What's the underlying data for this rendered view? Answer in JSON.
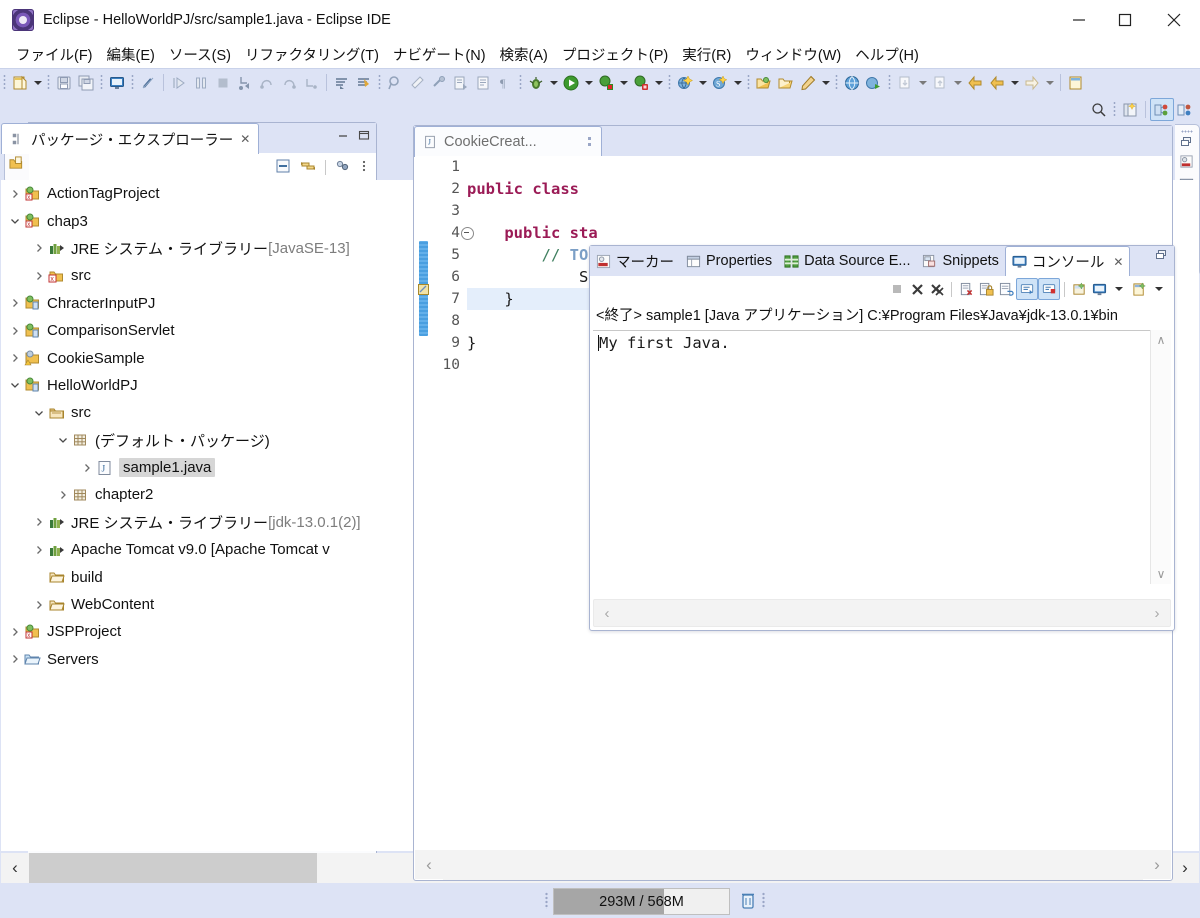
{
  "window": {
    "title": "Eclipse - HelloWorldPJ/src/sample1.java - Eclipse IDE",
    "icon": "eclipse-icon",
    "minimize_label": "—",
    "maximize_label": "□",
    "close_label": "✕"
  },
  "menubar": {
    "items": [
      {
        "label": "ファイル(F)"
      },
      {
        "label": "編集(E)"
      },
      {
        "label": "ソース(S)"
      },
      {
        "label": "リファクタリング(T)"
      },
      {
        "label": "ナビゲート(N)"
      },
      {
        "label": "検索(A)"
      },
      {
        "label": "プロジェクト(P)"
      },
      {
        "label": "実行(R)"
      },
      {
        "label": "ウィンドウ(W)"
      },
      {
        "label": "ヘルプ(H)"
      }
    ]
  },
  "toolbar": {
    "groups": [
      {
        "items": [
          "new-wizard-icon",
          "dropdown-arrow"
        ]
      },
      {
        "items": [
          "save-icon",
          "save-all-icon"
        ]
      },
      {
        "items": [
          "console-toggle-icon"
        ]
      },
      {
        "items": [
          "link-break-icon"
        ]
      },
      {
        "items": [
          "resume-icon",
          "suspend-icon",
          "terminate-icon",
          "step-into-icon",
          "step-over-icon",
          "step-return-icon",
          "drop-to-frame-icon"
        ]
      },
      {
        "items": [
          "next-annotation-icon",
          "previous-annotation-icon"
        ]
      },
      {
        "items": [
          "search-ref-icon",
          "clean-icon",
          "build-icon",
          "externaltools-icon",
          "editor-icon",
          "whitespace-icon"
        ]
      },
      {
        "items": [
          "debug-icon",
          "dropdown-arrow",
          "run-icon",
          "dropdown-arrow",
          "coverage-icon",
          "dropdown-arrow",
          "profile-icon",
          "dropdown-arrow"
        ]
      },
      {
        "items": [
          "new-java-project-icon",
          "dropdown-arrow",
          "new-class-icon",
          "dropdown-arrow"
        ]
      },
      {
        "items": [
          "open-type-icon",
          "open-task-icon",
          "new-annotation-icon",
          "dropdown-arrow"
        ]
      },
      {
        "items": [
          "web-browser-icon",
          "run-server-icon"
        ]
      },
      {
        "items": [
          "previous-edit-icon",
          "dropdown-arrow",
          "next-edit-icon",
          "dropdown-arrow"
        ]
      },
      {
        "items": [
          "back-icon",
          "forward-icon",
          "dropdown-arrow",
          "next-nav-icon",
          "dropdown-arrow"
        ]
      },
      {
        "items": [
          "new-perspective-icon"
        ]
      }
    ],
    "row2": [
      "search-icon",
      "open-perspective-icon",
      "java-ee-perspective-icon",
      "java-perspective-icon"
    ]
  },
  "package_explorer": {
    "tab_label": "パッケージ・エクスプローラー",
    "tab_icon": "package-explorer-icon",
    "close_label": "✕",
    "minimize_tip": "最小化",
    "maximize_tip": "最大化",
    "view_toolbar": [
      "collapse-all-icon",
      "link-with-editor-icon",
      "view-menu-icon",
      "view-dropdown-icon"
    ],
    "tree": [
      {
        "indent": 0,
        "twisty": "collapsed",
        "icon": "web-project-icon",
        "label": "ActionTagProject",
        "sub": "",
        "selected": false
      },
      {
        "indent": 0,
        "twisty": "expanded",
        "icon": "web-project-icon",
        "label": "chap3",
        "sub": "",
        "selected": false
      },
      {
        "indent": 1,
        "twisty": "collapsed",
        "icon": "library-icon",
        "label": "JRE システム・ライブラリー",
        "sub": "[JavaSE-13]",
        "selected": false
      },
      {
        "indent": 1,
        "twisty": "collapsed",
        "icon": "source-folder-icon",
        "label": "src",
        "sub": "",
        "selected": false
      },
      {
        "indent": 0,
        "twisty": "collapsed",
        "icon": "java-project-icon",
        "label": "ChracterInputPJ",
        "sub": "",
        "selected": false
      },
      {
        "indent": 0,
        "twisty": "collapsed",
        "icon": "java-project-icon",
        "label": "ComparisonServlet",
        "sub": "",
        "selected": false
      },
      {
        "indent": 0,
        "twisty": "collapsed",
        "icon": "java-project-warn-icon",
        "label": "CookieSample",
        "sub": "",
        "selected": false
      },
      {
        "indent": 0,
        "twisty": "expanded",
        "icon": "java-project-icon",
        "label": "HelloWorldPJ",
        "sub": "",
        "selected": false
      },
      {
        "indent": 1,
        "twisty": "expanded",
        "icon": "source-folder-plain-icon",
        "label": "src",
        "sub": "",
        "selected": false
      },
      {
        "indent": 2,
        "twisty": "expanded",
        "icon": "package-icon",
        "label": "(デフォルト・パッケージ)",
        "sub": "",
        "selected": false
      },
      {
        "indent": 3,
        "twisty": "collapsed",
        "icon": "java-file-icon",
        "label": "sample1.java",
        "sub": "",
        "selected": true
      },
      {
        "indent": 2,
        "twisty": "collapsed",
        "icon": "package-icon",
        "label": "chapter2",
        "sub": "",
        "selected": false
      },
      {
        "indent": 1,
        "twisty": "collapsed",
        "icon": "library-icon",
        "label": "JRE システム・ライブラリー",
        "sub": "[jdk-13.0.1(2)]",
        "selected": false
      },
      {
        "indent": 1,
        "twisty": "collapsed",
        "icon": "library-icon",
        "label": "Apache Tomcat v9.0 [Apache Tomcat v",
        "sub": "",
        "selected": false
      },
      {
        "indent": 1,
        "twisty": "none",
        "icon": "folder-icon",
        "label": "build",
        "sub": "",
        "selected": false
      },
      {
        "indent": 1,
        "twisty": "collapsed",
        "icon": "folder-icon",
        "label": "WebContent",
        "sub": "",
        "selected": false
      },
      {
        "indent": 0,
        "twisty": "collapsed",
        "icon": "web-project-icon",
        "label": "JSPProject",
        "sub": "",
        "selected": false
      },
      {
        "indent": 0,
        "twisty": "collapsed",
        "icon": "folder-open-icon",
        "label": "Servers",
        "sub": "",
        "selected": false
      }
    ],
    "hscroll": {
      "left_arrow": "‹",
      "right_arrow": "›"
    }
  },
  "editor": {
    "tab_label": "CookieCreat...",
    "tab_icon": "java-file-icon",
    "line_numbers": [
      "1",
      "2",
      "3",
      "4",
      "5",
      "6",
      "7",
      "8",
      "9",
      "10"
    ],
    "lines": [
      {
        "n": "1",
        "text": "",
        "kind": "plain"
      },
      {
        "n": "2",
        "text": "public class ",
        "kind": "decl"
      },
      {
        "n": "3",
        "text": "",
        "kind": "plain"
      },
      {
        "n": "4",
        "text": "    public sta",
        "kind": "method",
        "fold": true
      },
      {
        "n": "5",
        "text": "        // TODO",
        "kind": "comment"
      },
      {
        "n": "6",
        "text": "            System",
        "kind": "plain"
      },
      {
        "n": "7",
        "text": "    }",
        "kind": "plain",
        "highlight": true
      },
      {
        "n": "8",
        "text": "",
        "kind": "plain"
      },
      {
        "n": "9",
        "text": "}",
        "kind": "plain"
      },
      {
        "n": "10",
        "text": "",
        "kind": "plain"
      }
    ],
    "hscroll": {
      "left_arrow": "‹",
      "right_arrow": "›"
    }
  },
  "console_stack": {
    "tabs": [
      {
        "label": "マーカー",
        "icon": "markers-icon",
        "active": false
      },
      {
        "label": "Properties",
        "icon": "properties-icon",
        "active": false
      },
      {
        "label": "Data Source E...",
        "icon": "data-source-icon",
        "active": false
      },
      {
        "label": "Snippets",
        "icon": "snippets-icon",
        "active": false
      },
      {
        "label": "コンソール",
        "icon": "console-icon",
        "active": true,
        "close_label": "✕"
      }
    ],
    "restore_tip": "復元",
    "toolbar": [
      {
        "name": "terminate-icon",
        "enabled": false
      },
      {
        "name": "remove-launch-icon",
        "enabled": true
      },
      {
        "name": "remove-all-terminated-icon",
        "enabled": true
      },
      {
        "name": "clear-console-icon",
        "enabled": true
      },
      {
        "name": "scroll-lock-icon",
        "enabled": true
      },
      {
        "name": "word-wrap-icon",
        "enabled": true
      },
      {
        "name": "show-console-on-output-icon",
        "enabled": true,
        "toggled": true
      },
      {
        "name": "show-console-on-error-icon",
        "enabled": true,
        "toggled": true
      },
      {
        "name": "pin-console-icon",
        "enabled": true
      },
      {
        "name": "display-selected-console-icon",
        "enabled": true
      },
      {
        "name": "dropdown-arrow",
        "enabled": true
      },
      {
        "name": "open-console-icon",
        "enabled": true
      },
      {
        "name": "dropdown-arrow",
        "enabled": true
      }
    ],
    "header": "<終了> sample1 [Java アプリケーション] C:¥Program Files¥Java¥jdk-13.0.1¥bin",
    "output": "My first Java.",
    "vscroll": {
      "up_arrow": "∧",
      "down_arrow": "∨"
    },
    "hscroll": {
      "left_arrow": "‹",
      "right_arrow": "›"
    }
  },
  "fastview": {
    "left_items": [
      "restore-icon",
      "package-explorer-small-icon"
    ],
    "right_items": [
      "restore-icon",
      "markers-small-icon",
      "properties-small-icon",
      "data-source-small-icon",
      "snippets-small-icon",
      "console-small-icon"
    ]
  },
  "statusbar": {
    "heap_text": "293M / 568M",
    "heap_used": "293M",
    "heap_total": "568M",
    "heap_percent": 63,
    "trash_icon": "trash-icon"
  },
  "colors": {
    "chrome": "#dde3f5",
    "accent": "#4a9fe0",
    "keyword": "#9b1b56",
    "comment": "#3f7f5f",
    "todo": "#7c9fc6",
    "selection": "#d6d6d6",
    "highlight_line": "#e4eefb"
  }
}
